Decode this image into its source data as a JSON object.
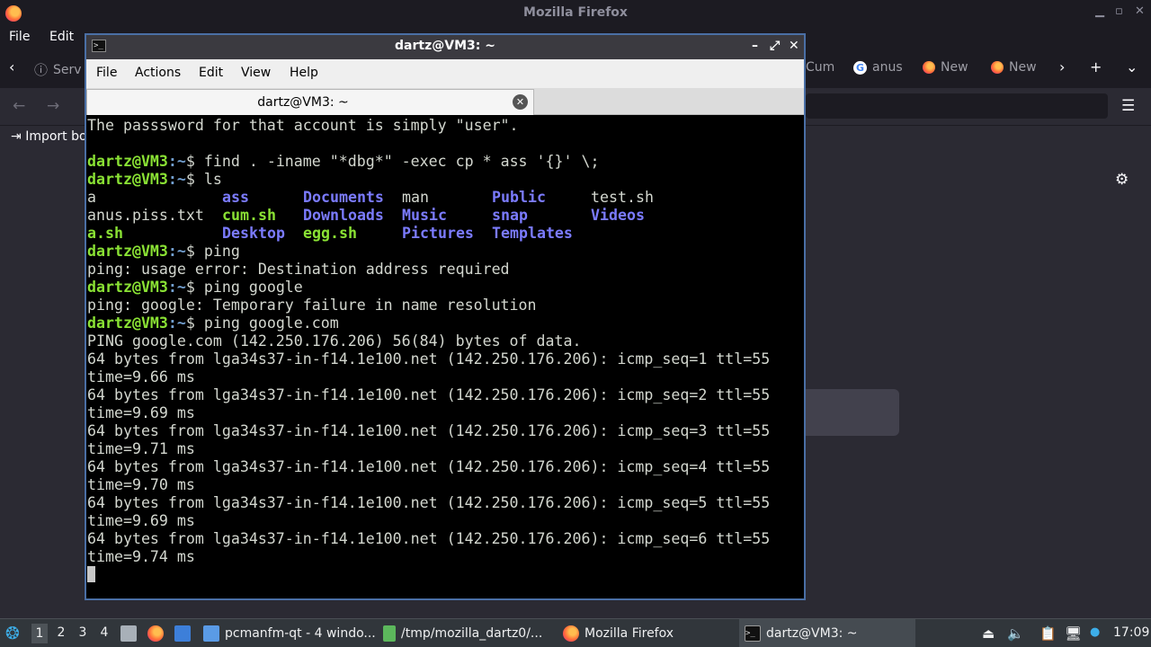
{
  "firefox": {
    "window_title": "Mozilla Firefox",
    "menu": {
      "file": "File",
      "edit": "Edit"
    },
    "tabs": {
      "first_tab": "Serv",
      "right_tabs": [
        {
          "label": "Cum",
          "icon": "firefox-icon"
        },
        {
          "label": "anus",
          "icon": "google-icon"
        },
        {
          "label": "New",
          "icon": "firefox-icon"
        },
        {
          "label": "New",
          "icon": "firefox-icon"
        }
      ]
    },
    "bookmarks": {
      "import": "Import bo"
    }
  },
  "terminal": {
    "window_title": "dartz@VM3: ~",
    "menu": {
      "file": "File",
      "actions": "Actions",
      "edit": "Edit",
      "view": "View",
      "help": "Help"
    },
    "tab_label": "dartz@VM3: ~",
    "prompt_user": "dartz@VM3",
    "prompt_path": ":~",
    "prompt_symbol": "$",
    "lines": {
      "l0": "The passsword for that account is simply \"user\".",
      "cmd1": " find . -iname \"*dbg*\" -exec cp * ass '{}' \\;",
      "cmd2": " ls",
      "cmd3": " ping",
      "out3": "ping: usage error: Destination address required",
      "cmd4": " ping google",
      "out4": "ping: google: Temporary failure in name resolution",
      "cmd5": " ping google.com",
      "out5": "PING google.com (142.250.176.206) 56(84) bytes of data.",
      "p1a": "64 bytes from lga34s37-in-f14.1e100.net (142.250.176.206): icmp_seq=1 ttl=55",
      "p1b": "time=9.66 ms",
      "p2a": "64 bytes from lga34s37-in-f14.1e100.net (142.250.176.206): icmp_seq=2 ttl=55",
      "p2b": "time=9.69 ms",
      "p3a": "64 bytes from lga34s37-in-f14.1e100.net (142.250.176.206): icmp_seq=3 ttl=55",
      "p3b": "time=9.71 ms",
      "p4a": "64 bytes from lga34s37-in-f14.1e100.net (142.250.176.206): icmp_seq=4 ttl=55",
      "p4b": "time=9.70 ms",
      "p5a": "64 bytes from lga34s37-in-f14.1e100.net (142.250.176.206): icmp_seq=5 ttl=55",
      "p5b": "time=9.69 ms",
      "p6a": "64 bytes from lga34s37-in-f14.1e100.net (142.250.176.206): icmp_seq=6 ttl=55",
      "p6b": "time=9.74 ms"
    },
    "ls": {
      "r0": {
        "c0": "a",
        "c1": "ass",
        "c2": "Documents",
        "c3": "man",
        "c4": "Public",
        "c5": "test.sh"
      },
      "r1": {
        "c0": "anus.piss.txt",
        "c1": "cum.sh",
        "c2": "Downloads",
        "c3": "Music",
        "c4": "snap",
        "c5": "Videos"
      },
      "r2": {
        "c0": "a.sh",
        "c1": "Desktop",
        "c2": "egg.sh",
        "c3": "Pictures",
        "c4": "Templates"
      }
    }
  },
  "taskbar": {
    "workspaces": [
      "1",
      "2",
      "3",
      "4"
    ],
    "tasks": {
      "pcmanfm": "pcmanfm-qt - 4 windo...",
      "tmp": "/tmp/mozilla_dartz0/...",
      "firefox": "Mozilla Firefox",
      "terminal": "dartz@VM3: ~"
    },
    "clock": "17:09"
  },
  "colors": {
    "prompt_green": "#8ae234",
    "directory_blue": "#7b7bff",
    "terminal_bg": "#000000",
    "firefox_dark": "#1c1b22",
    "taskbar_bg": "#31363b"
  }
}
